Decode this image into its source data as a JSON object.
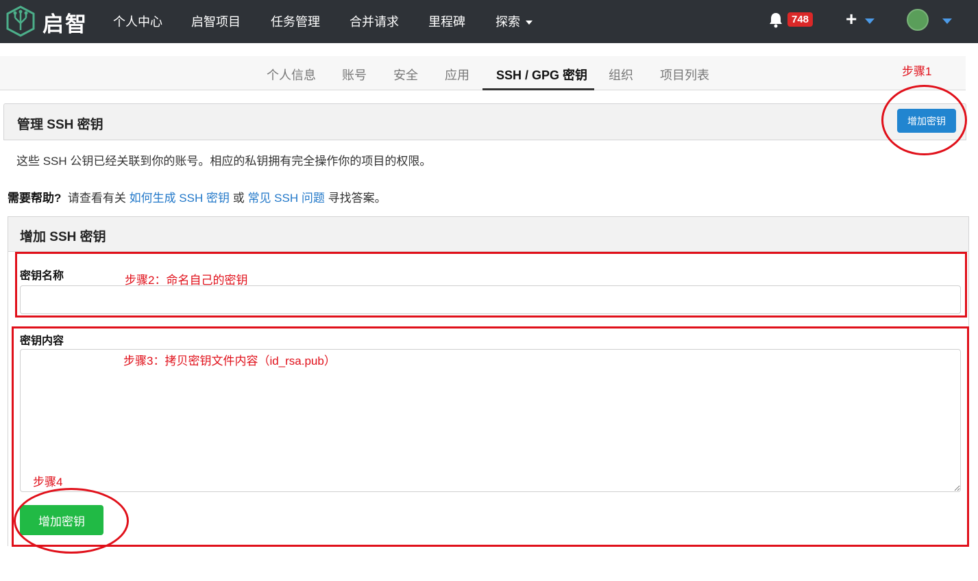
{
  "navbar": {
    "brand": "启智",
    "items": [
      "个人中心",
      "启智项目",
      "任务管理",
      "合并请求",
      "里程碑"
    ],
    "explore": "探索",
    "notification_count": "748",
    "plus": "+"
  },
  "tabs": [
    "个人信息",
    "账号",
    "安全",
    "应用",
    "SSH / GPG 密钥",
    "组织",
    "项目列表"
  ],
  "manage": {
    "title": "管理 SSH 密钥",
    "add_button": "增加密钥",
    "description": "这些 SSH 公钥已经关联到你的账号。相应的私钥拥有完全操作你的项目的权限。"
  },
  "help": {
    "label": "需要帮助?",
    "text1": "请查看有关",
    "link1": "如何生成 SSH 密钥",
    "or": "或",
    "link2": "常见 SSH 问题",
    "text2": "寻找答案。"
  },
  "add_form": {
    "title": "增加 SSH 密钥",
    "name_label": "密钥名称",
    "content_label": "密钥内容",
    "submit": "增加密钥"
  },
  "annotations": {
    "step1": "步骤1",
    "step2": "步骤2：命名自己的密钥",
    "step3": "步骤3：拷贝密钥文件内容（id_rsa.pub）",
    "step4": "步骤4"
  },
  "colors": {
    "navbar": "#2e3237",
    "primary": "#2185d0",
    "success": "#21ba45",
    "badge": "#db2828",
    "annotation": "#e0101a",
    "link": "#2278c9"
  }
}
